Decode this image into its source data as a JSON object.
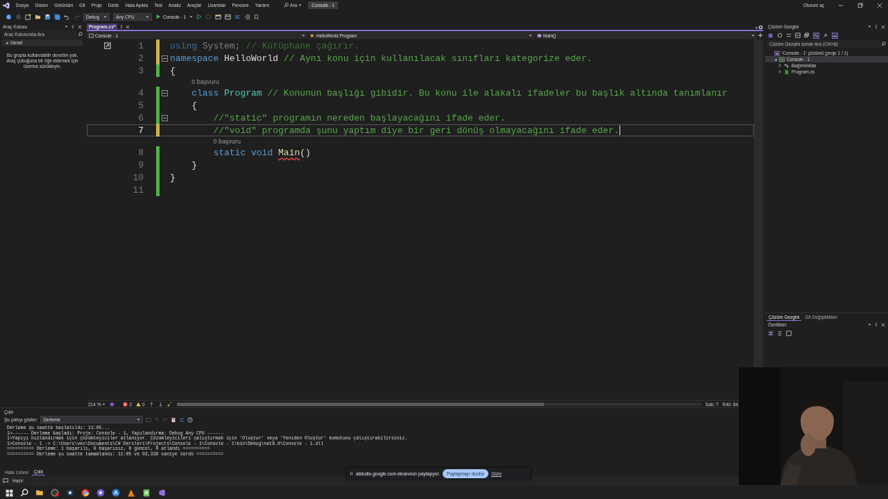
{
  "menu_bar": {
    "items": [
      "Dosya",
      "Düzen",
      "Görünüm",
      "Git",
      "Proje",
      "Derle",
      "Hata Ayıkla",
      "Test",
      "Analiz",
      "Araçlar",
      "Uzantılar",
      "Pencere",
      "Yardım"
    ],
    "search": "Ara",
    "solution_name": "Console - 1",
    "sign_in": "Oturum aç"
  },
  "toolbar": {
    "configuration": "Debug",
    "platform": "Any CPU",
    "start_target": "Console - 1"
  },
  "toolbox": {
    "title": "Araç Kutusu",
    "search_placeholder": "Araç Kutusunda Ara",
    "group": {
      "label": "Genel",
      "expanded": true
    },
    "message": "Bu grupta kullanılabilir denetim yok. Araç çubuğuna bir öğe eklemek için üzerine sürükleyin."
  },
  "editor": {
    "tab": {
      "label": "Program.cs*",
      "selected": true
    },
    "nav": [
      "Console - 1",
      "HelloWorld.Program",
      "Main()"
    ],
    "lines": [
      {
        "number": "1",
        "foldable": false,
        "saved": false,
        "current": false,
        "cursor": false,
        "tokens": [
          {
            "kind": "faded-keyword",
            "text": "using "
          },
          {
            "kind": "faded",
            "text": "System; "
          },
          {
            "kind": "faded-comment",
            "text": "// Kütüphane çağırır."
          }
        ]
      },
      {
        "number": "2",
        "foldable": true,
        "saved": false,
        "current": false,
        "cursor": false,
        "tokens": [
          {
            "kind": "keyword",
            "text": "namespace "
          },
          {
            "kind": "plain",
            "text": "HelloWorld "
          },
          {
            "kind": "comment",
            "text": "// Aynı konu için kullanılacak sınıfları kategorize eder."
          }
        ]
      },
      {
        "number": "3",
        "foldable": false,
        "saved": true,
        "current": false,
        "cursor": false,
        "tokens": [
          {
            "kind": "plain",
            "text": "{"
          }
        ]
      },
      {
        "number": "4",
        "foldable": true,
        "saved": true,
        "current": false,
        "cursor": false,
        "codelens": "0 başvuru",
        "tokens": [
          {
            "kind": "keyword",
            "text": "    class "
          },
          {
            "kind": "type",
            "text": "Program "
          },
          {
            "kind": "comment",
            "text": "// Konunun başlığı gibidir. Bu konu ile alakalı ifadeler bu başlık altında tanımlanır"
          }
        ]
      },
      {
        "number": "5",
        "foldable": false,
        "saved": true,
        "current": false,
        "cursor": false,
        "tokens": [
          {
            "kind": "plain",
            "text": "    {"
          }
        ]
      },
      {
        "number": "6",
        "foldable": true,
        "saved": true,
        "current": false,
        "cursor": false,
        "tokens": [
          {
            "kind": "comment",
            "text": "        //\"static\" programın nereden başlayacağını ifade eder."
          }
        ]
      },
      {
        "number": "7",
        "foldable": false,
        "saved": false,
        "current": true,
        "cursor": true,
        "tokens": [
          {
            "kind": "comment",
            "text": "        //\"void\" programda şunu yaptım diye bir geri dönüş olmayacağını ifade eder."
          }
        ]
      },
      {
        "number": "8",
        "foldable": false,
        "saved": true,
        "current": false,
        "cursor": false,
        "codelens": "0 başvuru",
        "tokens": [
          {
            "kind": "keyword",
            "text": "        static void "
          },
          {
            "kind": "error-method",
            "text": "Main"
          },
          {
            "kind": "plain",
            "text": "()"
          }
        ]
      },
      {
        "number": "9",
        "foldable": false,
        "saved": true,
        "current": false,
        "cursor": false,
        "tokens": [
          {
            "kind": "plain",
            "text": "    }"
          }
        ]
      },
      {
        "number": "10",
        "foldable": false,
        "saved": true,
        "current": false,
        "cursor": false,
        "tokens": [
          {
            "kind": "plain",
            "text": "}"
          }
        ]
      },
      {
        "number": "11",
        "foldable": false,
        "saved": true,
        "current": false,
        "cursor": false
      }
    ],
    "zoom": "214 %",
    "errors": "2",
    "warnings": "0",
    "line_position": "Satı: 7",
    "column_position": "Krkt: 84"
  },
  "solution_explorer": {
    "title": "Çözüm Gezgini",
    "search_placeholder": "Çözüm Gezgini İçinde Ara (Ctrl+ğ)",
    "tree": [
      {
        "label": "'Console - 1' çözümü (proje 1 / 1)",
        "kind": "solution",
        "selected": false,
        "children": [
          {
            "label": "Console - 1",
            "kind": "project",
            "expanded": true,
            "selected": true,
            "children": [
              {
                "label": "Bağımlılıklar",
                "kind": "dependencies",
                "expanded": false,
                "selected": false
              },
              {
                "label": "Program.cs",
                "kind": "file",
                "expanded": false,
                "selected": false
              }
            ]
          }
        ]
      }
    ],
    "tabs": [
      {
        "label": "Çözüm Gezgini",
        "selected": true
      },
      {
        "label": "Git Değişiklikleri",
        "selected": false
      }
    ]
  },
  "properties": {
    "title": "Özellikler"
  },
  "output": {
    "title": "Çıktı",
    "source_label": "Şu çıktıyı göster:",
    "source": "Derleme",
    "lines": [
      "Derleme şu saatte başlatıldı: 11:05...",
      "1>------ Derleme başladı: Proje: Console - 1, Yapılandırma: Debug Any CPU ------",
      "1>Yapıyı hızlandırmak için çözümleyiciler atlanıyor. Çözümleyicileri çalıştırmak için 'Oluştur' veya 'Yeniden Oluştur' komutunu çalıştırabilirsiniz.",
      "1>Console - 1 -> C:\\Users\\vec\\Documents\\C# Dersleri\\Projects\\Console - 1\\Console - 1\\bin\\Debug\\net8.0\\Console - 1.dll",
      "========== Derleme: 1 başarılı, 0 başarısız, 0 güncel, 0 atlandı ==========",
      "========== Derleme şu saatte tamamlandı: 11:05 ve 02,339 saniye sürdü =========="
    ]
  },
  "bottom_tabs": [
    {
      "label": "Hata Listesi",
      "selected": false
    },
    {
      "label": "Çıktı",
      "selected": true
    }
  ],
  "status_bar": {
    "text": "Hazır"
  },
  "sharing_bar": {
    "message": "aistudio.google.com ekranınızı paylaşıyor.",
    "stop_button": "Paylaşmayı durdur",
    "hide_link": "Gizle"
  }
}
